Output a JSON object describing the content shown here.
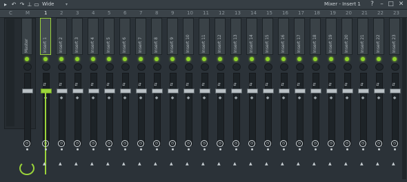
{
  "toolbar": {
    "icons": [
      "menu-arrow",
      "undo",
      "redo",
      "pin",
      "panel"
    ],
    "view_mode": "Wide",
    "view_arrow": "▾",
    "window_title": "Mixer - Insert 1",
    "buttons": [
      "?",
      "–",
      "□",
      "✕"
    ]
  },
  "header": {
    "master_cols": [
      "C",
      "M"
    ],
    "tracks": [
      "1",
      "2",
      "3",
      "4",
      "5",
      "6",
      "7",
      "8",
      "9",
      "10",
      "11",
      "12",
      "13",
      "14",
      "15",
      "16",
      "17",
      "18",
      "19",
      "20",
      "21",
      "22",
      "23"
    ]
  },
  "master": {
    "label": "Master"
  },
  "inserts": [
    "Insert 1",
    "Insert 2",
    "Insert 3",
    "Insert 4",
    "Insert 5",
    "Insert 6",
    "Insert 7",
    "Insert 8",
    "Insert 9",
    "Insert 10",
    "Insert 11",
    "Insert 12",
    "Insert 13",
    "Insert 14",
    "Insert 15",
    "Insert 16",
    "Insert 17",
    "Insert 18",
    "Insert 19",
    "Insert 20",
    "Insert 21",
    "Insert 22",
    "Insert 23"
  ],
  "selected_insert": 1,
  "colors": {
    "accent": "#9bd43a",
    "panel": "#2b3238",
    "led": "#8dd22a"
  }
}
